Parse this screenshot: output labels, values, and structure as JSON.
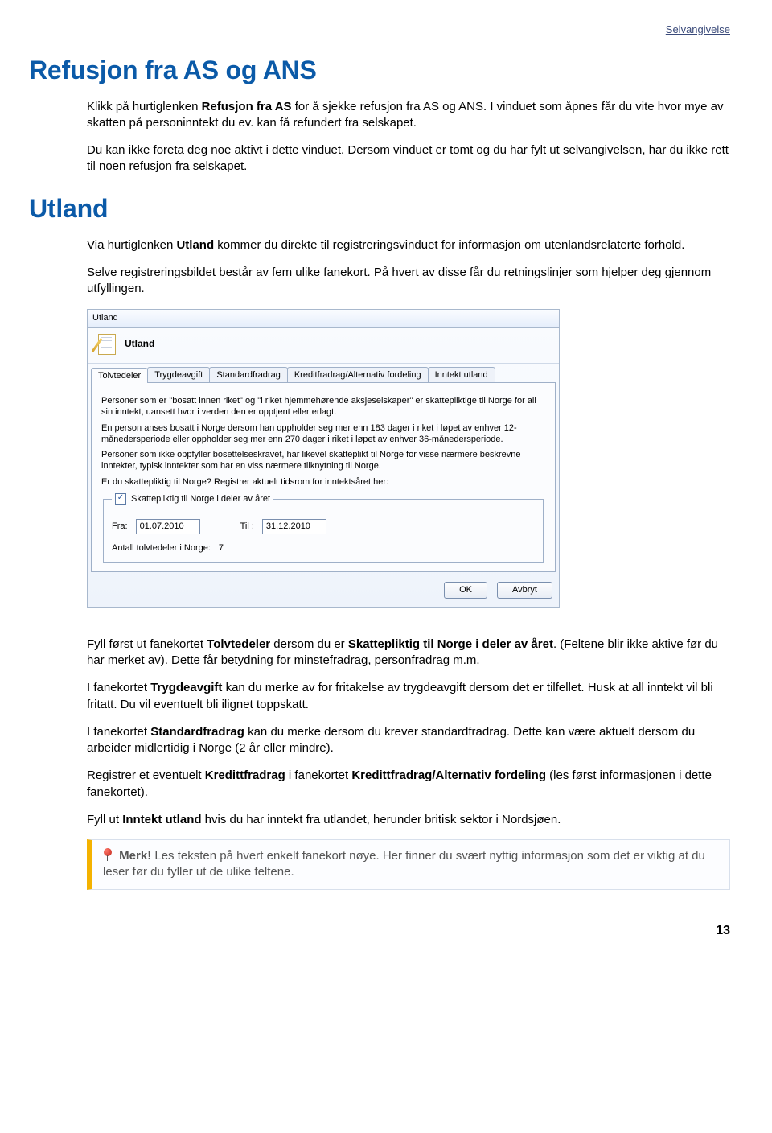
{
  "top_link": "Selvangivelse",
  "h1_refusjon": "Refusjon fra AS og ANS",
  "refusjon_p1_a": "Klikk på hurtiglenken ",
  "refusjon_p1_b": "Refusjon fra AS",
  "refusjon_p1_c": " for å sjekke refusjon fra AS og ANS. I vinduet som åpnes får du vite hvor mye av skatten på personinntekt du ev. kan få refundert fra selskapet.",
  "refusjon_p2": "Du kan ikke foreta deg noe aktivt i dette vinduet. Dersom vinduet er tomt og du har fylt ut selvangivelsen, har du ikke rett til noen refusjon fra selskapet.",
  "h1_utland": "Utland",
  "utland_p1_a": "Via hurtiglenken ",
  "utland_p1_b": "Utland",
  "utland_p1_c": " kommer du direkte til registreringsvinduet for informasjon om utenlandsrelaterte forhold.",
  "utland_p2": "Selve registreringsbildet består av fem ulike fanekort. På hvert av disse får du retningslinjer som hjelper deg gjennom utfyllingen.",
  "dialog": {
    "title": "Utland",
    "section": "Utland",
    "tabs": [
      "Tolvtedeler",
      "Trygdeavgift",
      "Standardfradrag",
      "Kreditfradrag/Alternativ fordeling",
      "Inntekt utland"
    ],
    "info1": "Personer som er \"bosatt innen riket\" og \"i riket hjemmehørende aksjeselskaper\" er skattepliktige til Norge for all sin inntekt, uansett hvor i verden den er opptjent eller erlagt.",
    "info2": "En person anses bosatt i Norge dersom han oppholder seg mer enn 183 dager i riket i løpet av enhver 12-månedersperiode eller oppholder seg mer enn 270 dager i riket i løpet av enhver 36-månedersperiode.",
    "info3": "Personer som ikke oppfyller bosettelseskravet, har likevel skatteplikt til Norge for visse nærmere beskrevne inntekter, typisk inntekter som har en viss nærmere tilknytning til Norge.",
    "info4": "Er du skattepliktig til Norge? Registrer aktuelt tidsrom for inntektsåret her:",
    "legend": "Skattepliktig til Norge i deler av året",
    "fra_label": "Fra:",
    "fra_value": "01.07.2010",
    "til_label": "Til :",
    "til_value": "31.12.2010",
    "antall_label": "Antall tolvtedeler i Norge:",
    "antall_value": "7",
    "ok": "OK",
    "avbryt": "Avbryt"
  },
  "after1_a": "Fyll først ut fanekortet ",
  "after1_b": "Tolvtedeler",
  "after1_c": " dersom du er ",
  "after1_d": "Skattepliktig til Norge i deler av året",
  "after1_e": ". (Feltene blir ikke aktive før du har merket av). Dette får betydning for minstefradrag, personfradrag m.m.",
  "after2_a": "I fanekortet ",
  "after2_b": "Trygdeavgift",
  "after2_c": " kan du merke av for fritakelse av trygdeavgift dersom det er tilfellet. Husk at all inntekt vil bli fritatt. Du vil eventuelt bli ilignet toppskatt.",
  "after3_a": "I fanekortet ",
  "after3_b": "Standardfradrag",
  "after3_c": " kan du merke dersom du krever standardfradrag. Dette kan være aktuelt dersom du arbeider midlertidig i Norge (2 år eller mindre).",
  "after4_a": "Registrer et eventuelt ",
  "after4_b": "Kredittfradrag",
  "after4_c": " i fanekortet ",
  "after4_d": "Kredittfradrag/Alternativ fordeling",
  "after4_e": " (les først informasjonen i dette fanekortet).",
  "after5_a": "Fyll ut ",
  "after5_b": "Inntekt utland",
  "after5_c": " hvis du har inntekt fra utlandet, herunder britisk sektor i Nordsjøen.",
  "merk_lead": "Merk!",
  "merk_text": " Les teksten på hvert enkelt fanekort nøye. Her finner du svært nyttig informasjon som det er viktig at du leser før du fyller ut de ulike feltene.",
  "page_num": "13"
}
